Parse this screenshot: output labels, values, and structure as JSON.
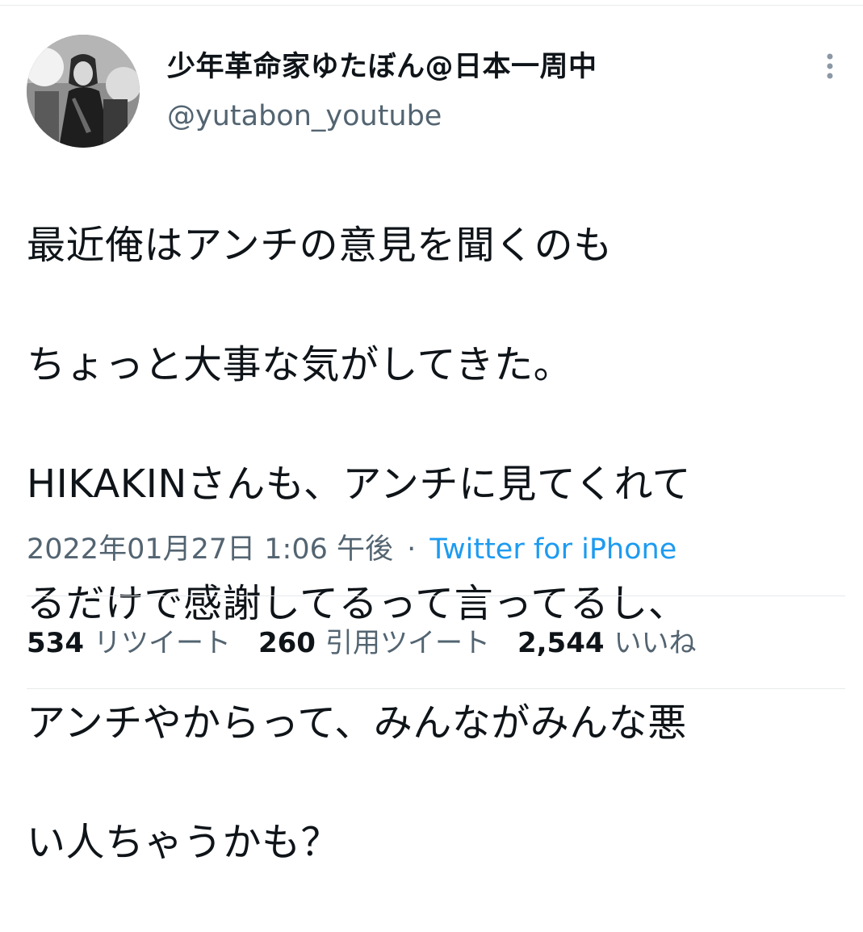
{
  "tweet": {
    "author": {
      "display_name": "少年革命家ゆたぼん@日本一周中",
      "handle": "@yutabon_youtube",
      "avatar_icon": "avatar-photo"
    },
    "more_icon": "more-vertical-icon",
    "text_lines": [
      "最近俺はアンチの意見を聞くのも",
      "ちょっと大事な気がしてきた。",
      "HIKAKINさんも、アンチに見てくれて",
      "るだけで感謝してるって言ってるし、",
      "アンチやからって、みんながみんな悪",
      "い人ちゃうかも？"
    ],
    "timestamp": "2022年01月27日 1:06 午後",
    "separator": "·",
    "source": "Twitter for iPhone",
    "stats": {
      "retweets_count": "534",
      "retweets_label": "リツイート",
      "quotes_count": "260",
      "quotes_label": "引用ツイート",
      "likes_count": "2,544",
      "likes_label": "いいね"
    },
    "colors": {
      "link": "#1d9bf0",
      "secondary_text": "#536471",
      "primary_text": "#0f1419",
      "divider": "#e6e9ec"
    }
  }
}
